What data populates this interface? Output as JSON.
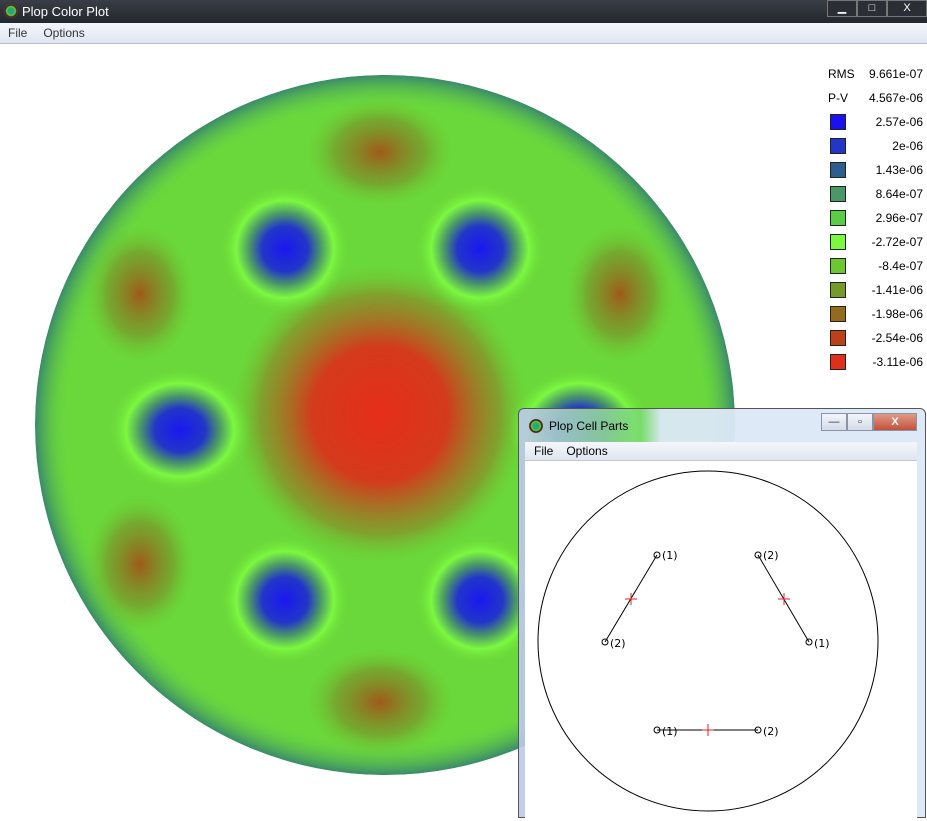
{
  "main_window": {
    "title": "Plop Color Plot",
    "menu": [
      "File",
      "Options"
    ],
    "controls": {
      "minimize": "▁",
      "maximize": "□",
      "close": "X"
    }
  },
  "legend": {
    "rms_label": "RMS",
    "rms_value": "9.661e-07",
    "pv_label": "P-V",
    "pv_value": "4.567e-06",
    "items": [
      {
        "value": "2.57e-06",
        "color": "#1a10f0"
      },
      {
        "value": "2e-06",
        "color": "#2236c8"
      },
      {
        "value": "1.43e-06",
        "color": "#2e5e8e"
      },
      {
        "value": "8.64e-07",
        "color": "#4a9868"
      },
      {
        "value": "2.96e-07",
        "color": "#5ccc48"
      },
      {
        "value": "-2.72e-07",
        "color": "#7cf840"
      },
      {
        "value": "-8.4e-07",
        "color": "#6cc830"
      },
      {
        "value": "-1.41e-06",
        "color": "#749a28"
      },
      {
        "value": "-1.98e-06",
        "color": "#946a1c"
      },
      {
        "value": "-2.54e-06",
        "color": "#bc4018"
      },
      {
        "value": "-3.11e-06",
        "color": "#e0301c"
      }
    ]
  },
  "cell_window": {
    "title": "Plop Cell Parts",
    "menu": [
      "File",
      "Options"
    ],
    "controls": {
      "minimize": "—",
      "maximize": "▫",
      "close": "X"
    },
    "labels": {
      "p1": "(1)",
      "p2": "(2)"
    }
  }
}
